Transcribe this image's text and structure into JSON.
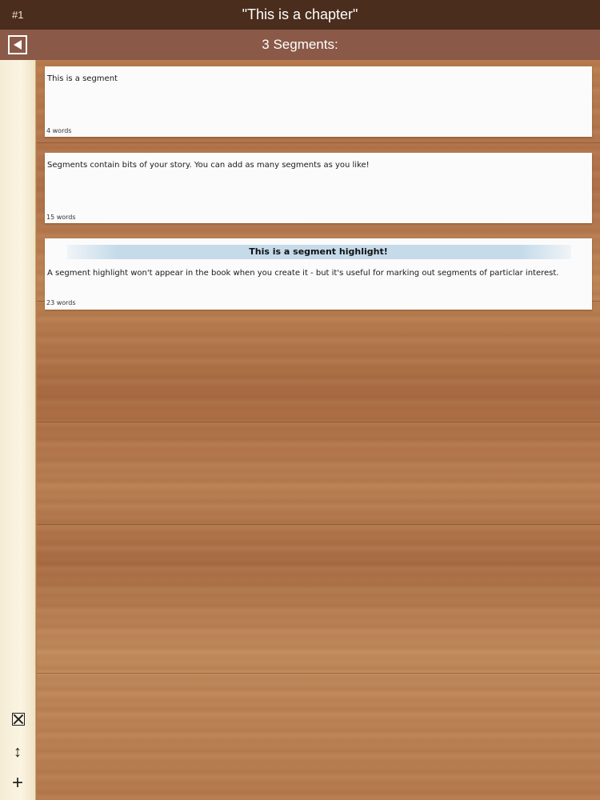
{
  "header": {
    "chapter_number": "#1",
    "chapter_title": "\"This is a chapter\""
  },
  "subheader": {
    "segments_label": "3 Segments:",
    "back_icon": "back-arrow-icon"
  },
  "segments": [
    {
      "text": "This is a segment",
      "word_count": "4 words"
    },
    {
      "text": "Segments contain bits of your story. You can add as many segments as you like!",
      "word_count": "15 words"
    },
    {
      "highlight": "This is a segment highlight!",
      "text": "A segment highlight won't appear in the book when you create it - but it's useful for marking out segments of particlar interest.",
      "word_count": "23 words"
    }
  ],
  "toolbar": {
    "icons": [
      "delete-box-icon",
      "reorder-icon",
      "add-icon"
    ]
  },
  "colors": {
    "title_bar": "#4a2d1c",
    "sub_bar": "#8a5948",
    "highlight": "#c5dbea",
    "paper": "#fbf4e2"
  }
}
